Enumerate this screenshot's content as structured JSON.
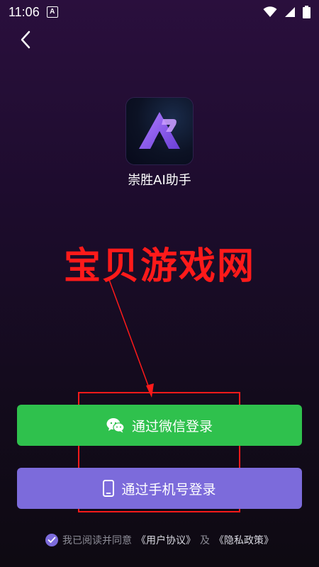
{
  "status_bar": {
    "time": "11:06",
    "notification_badge": "A",
    "icons": [
      "wifi-icon",
      "signal-icon",
      "battery-icon"
    ]
  },
  "header": {
    "back_icon": "back-arrow-icon"
  },
  "app": {
    "name": "崇胜AI助手",
    "logo_icon": "app-logo-icon"
  },
  "watermark": {
    "text": "宝贝游戏网"
  },
  "login": {
    "wechat_label": "通过微信登录",
    "wechat_icon": "wechat-icon",
    "phone_label": "通过手机号登录",
    "phone_icon": "phone-icon"
  },
  "agreement": {
    "checked": true,
    "prefix": "我已阅读并同意",
    "user_agreement": "《用户协议》",
    "conjunction": "及",
    "privacy_policy": "《隐私政策》"
  },
  "colors": {
    "wechat_button": "#2fc14d",
    "phone_button": "#7c6bdb",
    "watermark": "#ff1a1a",
    "annotation": "#ff1a1a"
  }
}
